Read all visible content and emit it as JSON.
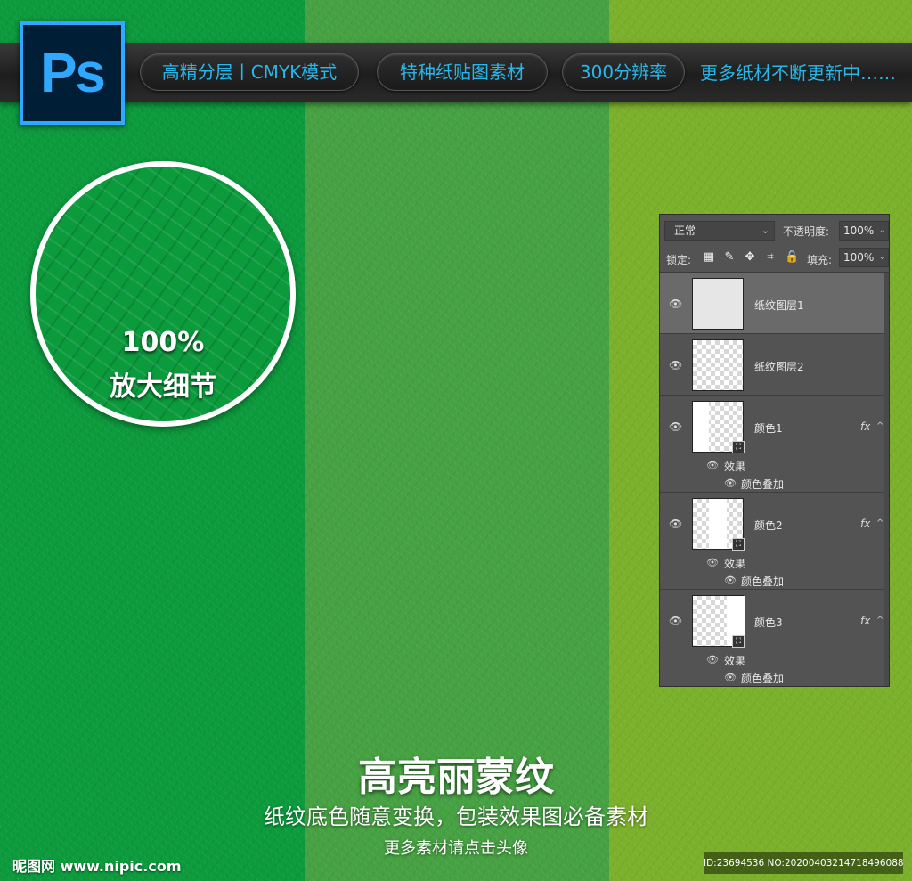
{
  "logo": {
    "text": "Ps"
  },
  "banner": {
    "pills": [
      "高精分层丨CMYK模式",
      "特种纸贴图素材",
      "300分辨率"
    ],
    "tagline": "更多纸材不断更新中……"
  },
  "zoom": {
    "percent": "100%",
    "caption": "放大细节"
  },
  "panel": {
    "blend_mode": "正常",
    "opacity_label": "不透明度:",
    "opacity_value": "100%",
    "lock_label": "锁定:",
    "fill_label": "填充:",
    "fill_value": "100%",
    "layers": [
      {
        "name": "纸纹图层1"
      },
      {
        "name": "纸纹图层2"
      },
      {
        "name": "颜色1",
        "fx": "fx",
        "effects_label": "效果",
        "effect_name": "颜色叠加"
      },
      {
        "name": "颜色2",
        "fx": "fx",
        "effects_label": "效果",
        "effect_name": "颜色叠加"
      },
      {
        "name": "颜色3",
        "fx": "fx",
        "effects_label": "效果",
        "effect_name": "颜色叠加"
      }
    ]
  },
  "bottom": {
    "title": "高亮丽蒙纹",
    "subtitle": "纸纹底色随意变换，包装效果图必备素材",
    "subtitle2": "更多素材请点击头像"
  },
  "watermark": "昵图网 www.nipic.com",
  "image_id": "ID:23694536 NO:20200403214718496088",
  "colors": {
    "stripe_left": "#0b9a3c",
    "stripe_middle": "#46a142",
    "stripe_right": "#7bb02a",
    "accent_blue": "#29b6e8"
  }
}
